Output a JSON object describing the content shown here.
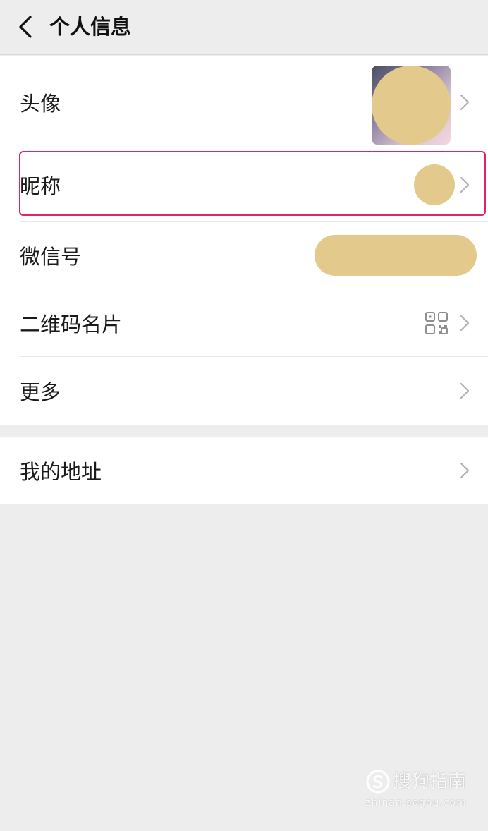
{
  "header": {
    "title": "个人信息",
    "back_icon": "chevron-left-icon"
  },
  "profile_items": [
    {
      "label": "头像",
      "value_type": "avatar-image"
    },
    {
      "label": "昵称",
      "value_type": "redacted",
      "highlighted": true
    },
    {
      "label": "微信号",
      "value_type": "redacted"
    },
    {
      "label": "二维码名片",
      "value_type": "qr-code-icon"
    },
    {
      "label": "更多",
      "value_type": "none"
    }
  ],
  "address_item": {
    "label": "我的地址"
  },
  "watermark": {
    "brand": "搜狗指南",
    "url": "zhinan.sogou.com"
  },
  "colors": {
    "background": "#ededed",
    "card": "#ffffff",
    "highlight_border": "#e0245e",
    "redaction": "#e3ca8c"
  }
}
